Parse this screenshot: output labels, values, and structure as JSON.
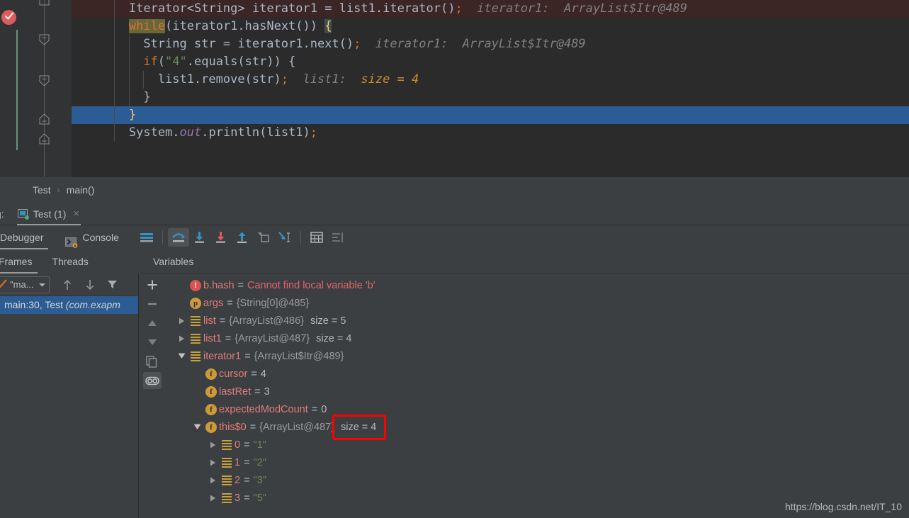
{
  "editor": {
    "top_fragment": {
      "comment": "//",
      "brace": "}"
    },
    "lines": [
      {
        "id": "line-iterator-decl",
        "indent": 2,
        "state": "breakpoint",
        "tokens": [
          {
            "t": "Iterator<String> iterator1 = list1.iterator()",
            "c": "punct"
          },
          {
            "t": ";",
            "c": "semi"
          }
        ],
        "hint_name": "iterator1:",
        "hint_value": "ArrayList$Itr@489"
      },
      {
        "id": "line-while",
        "indent": 2,
        "state": "normal",
        "tokens": [
          {
            "t": "while",
            "c": "kw-hl"
          },
          {
            "t": "(iterator1.hasNext()) ",
            "c": "punct"
          },
          {
            "t": "{",
            "c": "brace-hl"
          }
        ],
        "hint_name": "",
        "hint_value": ""
      },
      {
        "id": "line-string-str",
        "indent": 3,
        "state": "normal",
        "tokens": [
          {
            "t": "String str = iterator1.next()",
            "c": "punct"
          },
          {
            "t": ";",
            "c": "semi"
          }
        ],
        "hint_name": "iterator1:",
        "hint_value": "ArrayList$Itr@489"
      },
      {
        "id": "line-if-equals",
        "indent": 3,
        "state": "normal",
        "tokens": [
          {
            "t": "if",
            "c": "kw"
          },
          {
            "t": "(",
            "c": "punct"
          },
          {
            "t": "\"4\"",
            "c": "str"
          },
          {
            "t": ".equals(str)) {",
            "c": "punct"
          }
        ],
        "hint_name": "",
        "hint_value": ""
      },
      {
        "id": "line-remove",
        "indent": 4,
        "state": "normal",
        "tokens": [
          {
            "t": "list1.remove(str)",
            "c": "punct"
          },
          {
            "t": ";",
            "c": "semi"
          }
        ],
        "hint_name": "list1:",
        "hint_value": "size = 4"
      },
      {
        "id": "line-close-if",
        "indent": 3,
        "state": "normal",
        "tokens": [
          {
            "t": "}",
            "c": "punct"
          }
        ],
        "hint_name": "",
        "hint_value": ""
      },
      {
        "id": "line-close-while",
        "indent": 2,
        "state": "selected",
        "tokens": [
          {
            "t": "}",
            "c": "brace-y"
          }
        ],
        "hint_name": "",
        "hint_value": ""
      },
      {
        "id": "line-println",
        "indent": 2,
        "state": "normal",
        "tokens": [
          {
            "t": "System.",
            "c": "punct"
          },
          {
            "t": "out",
            "c": "fld"
          },
          {
            "t": ".println(list1)",
            "c": "punct"
          },
          {
            "t": ";",
            "c": "semi"
          }
        ],
        "hint_name": "",
        "hint_value": ""
      }
    ]
  },
  "breadcrumb": {
    "class_name": "Test",
    "separator": "›",
    "method_name": "main()"
  },
  "tabbar": {
    "debug_label": "g:",
    "run_tab_label": "Test (1)",
    "close_label": "×"
  },
  "debug_toolbar": {
    "tab_debugger": "Debugger",
    "tab_console": "Console",
    "icons": [
      "layout-icon",
      "step-over-icon",
      "step-into-icon",
      "force-step-into-icon",
      "step-out-icon",
      "drop-frame-icon",
      "run-to-cursor-icon",
      "evaluate-expression-icon",
      "settings-icon"
    ]
  },
  "frames": {
    "tab_frames": "Frames",
    "tab_threads": "Threads",
    "thread_selector": "\"ma...",
    "stack_frame": "main:30, Test ",
    "stack_frame_pkg": "(com.exapm",
    "toolbar_icons": [
      "arrow-up-icon",
      "arrow-down-icon",
      "filter-icon"
    ]
  },
  "variables": {
    "tab_label": "Variables",
    "sidebar_icons": [
      "add-icon",
      "remove-icon",
      "move-up-icon",
      "move-down-icon",
      "copy-icon",
      "watches-icon"
    ],
    "rows": [
      {
        "id": "var-b-hash",
        "depth": 0,
        "arrow": "none",
        "icon": "error-icon",
        "name": "b.hash",
        "eq": "=",
        "value": "Cannot find local variable 'b'",
        "value_class": "verr",
        "extra": ""
      },
      {
        "id": "var-args",
        "depth": 0,
        "arrow": "none",
        "icon": "param-icon",
        "name": "args",
        "eq": "=",
        "value": "{String[0]@485}",
        "value_class": "vref",
        "extra": ""
      },
      {
        "id": "var-list",
        "depth": 0,
        "arrow": "collapsed",
        "icon": "list-icon",
        "name": "list",
        "eq": "=",
        "value": "{ArrayList@486}",
        "value_class": "vref",
        "extra": "size = 5"
      },
      {
        "id": "var-list1",
        "depth": 0,
        "arrow": "collapsed",
        "icon": "list-icon",
        "name": "list1",
        "eq": "=",
        "value": "{ArrayList@487}",
        "value_class": "vref",
        "extra": "size = 4"
      },
      {
        "id": "var-iterator1",
        "depth": 0,
        "arrow": "expanded",
        "icon": "list-icon",
        "name": "iterator1",
        "eq": "=",
        "value": "{ArrayList$Itr@489}",
        "value_class": "vref",
        "extra": ""
      },
      {
        "id": "var-cursor",
        "depth": 1,
        "arrow": "none",
        "icon": "field-icon",
        "name": "cursor",
        "eq": "=",
        "value": "4",
        "value_class": "vnum",
        "extra": ""
      },
      {
        "id": "var-lastret",
        "depth": 1,
        "arrow": "none",
        "icon": "field-icon",
        "name": "lastRet",
        "eq": "=",
        "value": "3",
        "value_class": "vnum",
        "extra": ""
      },
      {
        "id": "var-expectedmodcount",
        "depth": 1,
        "arrow": "none",
        "icon": "field-icon",
        "name": "expectedModCount",
        "eq": "=",
        "value": "0",
        "value_class": "vnum",
        "extra": ""
      },
      {
        "id": "var-this0",
        "depth": 1,
        "arrow": "expanded",
        "icon": "field-icon",
        "name": "this$0",
        "eq": "=",
        "value": "{ArrayList@487}",
        "value_class": "vref",
        "extra": "size = 4"
      },
      {
        "id": "var-elem-0",
        "depth": 2,
        "arrow": "collapsed",
        "icon": "list-icon",
        "name": "0",
        "eq": "=",
        "value": "\"1\"",
        "value_class": "vstr",
        "extra": ""
      },
      {
        "id": "var-elem-1",
        "depth": 2,
        "arrow": "collapsed",
        "icon": "list-icon",
        "name": "1",
        "eq": "=",
        "value": "\"2\"",
        "value_class": "vstr",
        "extra": ""
      },
      {
        "id": "var-elem-2",
        "depth": 2,
        "arrow": "collapsed",
        "icon": "list-icon",
        "name": "2",
        "eq": "=",
        "value": "\"3\"",
        "value_class": "vstr",
        "extra": ""
      },
      {
        "id": "var-elem-3",
        "depth": 2,
        "arrow": "collapsed",
        "icon": "list-icon",
        "name": "3",
        "eq": "=",
        "value": "\"5\"",
        "value_class": "vstr",
        "extra": ""
      }
    ]
  },
  "annotation": {
    "highlight_text": "size = 4",
    "color": "#ff0000"
  },
  "watermark": {
    "text": "https://blog.csdn.net/IT_10"
  },
  "colors": {
    "editor_bg": "#2b2b2b",
    "panel_bg": "#3c3f41",
    "gutter_bg": "#313335",
    "selection_blue": "#2b5c93",
    "breakpoint_row": "#3b2525",
    "keyword_orange": "#cc7832",
    "string_green": "#6a8759",
    "identifier": "#a9b7c6",
    "hint_gray": "#808080",
    "var_name_red": "#e07b7b",
    "icon_gold": "#cc9a3d",
    "accent_blue": "#3592c4",
    "error_red": "#e36464"
  }
}
